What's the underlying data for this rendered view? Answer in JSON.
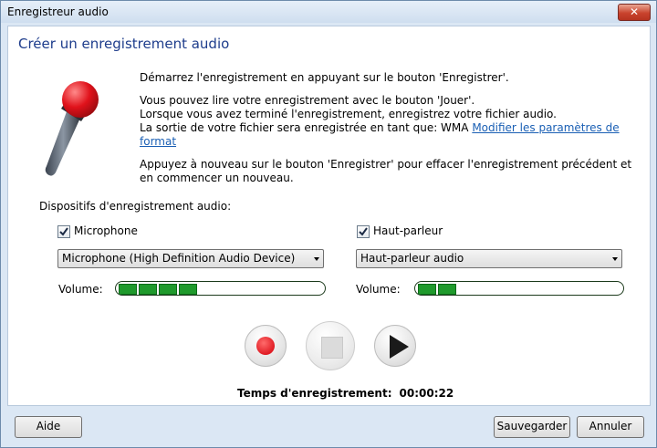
{
  "window": {
    "title": "Enregistreur audio",
    "close_glyph": "✕"
  },
  "heading": "Créer un enregistrement audio",
  "instructions": {
    "line1": "Démarrez l'enregistrement en appuyant sur le bouton 'Enregistrer'.",
    "line2": "Vous pouvez lire votre enregistrement avec le bouton 'Jouer'.",
    "line3": "Lorsque vous avez terminé l'enregistrement, enregistrez votre fichier audio.",
    "line4": "La sortie de votre fichier sera enregistrée en tant que: WMA",
    "format_link": "Modifier les paramètres de format",
    "line5": "Appuyez à nouveau sur le bouton 'Enregistrer' pour effacer l'enregistrement précédent et en commencer un nouveau."
  },
  "devices": {
    "label": "Dispositifs d'enregistrement audio:",
    "microphone": {
      "checkbox_label": "Microphone",
      "checked": true,
      "selected_device": "Microphone (High Definition Audio Device)",
      "volume_label": "Volume:",
      "level_segments": 4
    },
    "speaker": {
      "checkbox_label": "Haut-parleur",
      "checked": true,
      "selected_device": "Haut-parleur audio",
      "volume_label": "Volume:",
      "level_segments": 2
    }
  },
  "controls": {
    "record_icon": "record-icon",
    "stop_icon": "stop-icon",
    "play_icon": "play-icon",
    "stop_enabled": false
  },
  "recording_time": {
    "label": "Temps d'enregistrement:",
    "value": "00:00:22"
  },
  "footer": {
    "help": "Aide",
    "save": "Sauvegarder",
    "cancel": "Annuler"
  },
  "colors": {
    "heading": "#1e3d8c",
    "link": "#1a5fb4",
    "record": "#e01c24",
    "meter": "#1f9a2c"
  }
}
